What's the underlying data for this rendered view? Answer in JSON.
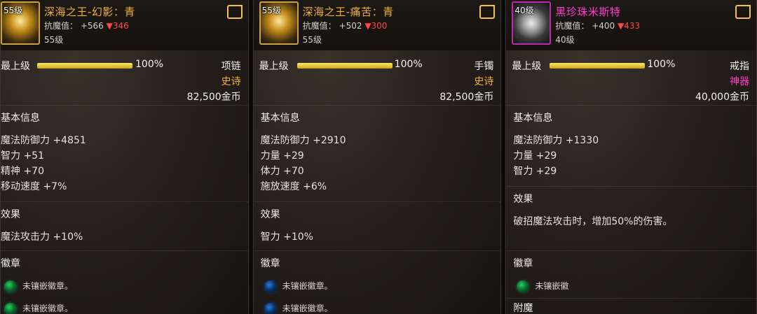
{
  "panels": [
    {
      "icon_level": "55级",
      "name": "深海之王-幻影：青",
      "resist_label": "抗魔值：",
      "resist_up": "+566",
      "resist_down": "▼346",
      "sub_level": "55级",
      "max_label": "最上级",
      "percent": "100%",
      "slot": "项链",
      "rarity": "史诗",
      "price": "82,500金币",
      "basic_info_title": "基本信息",
      "stats": [
        "魔法防御力 +4851",
        "智力 +51",
        "精神 +70",
        "移动速度 +7%"
      ],
      "effect_title": "效果",
      "effect_text": "魔法攻击力 +10%",
      "emblem_title": "徽章",
      "emblems": [
        "未镶嵌徽章。",
        "未镶嵌徽章。"
      ]
    },
    {
      "icon_level": "55级",
      "name": "深海之王-痛苦：青",
      "resist_label": "抗魔值：",
      "resist_up": "+502",
      "resist_down": "▼300",
      "sub_level": "55级",
      "max_label": "最上级",
      "percent": "100%",
      "slot": "手镯",
      "rarity": "史诗",
      "price": "82,500金币",
      "basic_info_title": "基本信息",
      "stats": [
        "魔法防御力 +2910",
        "力量 +29",
        "体力 +70",
        "施放速度 +6%"
      ],
      "effect_title": "效果",
      "effect_text": "智力 +10%",
      "emblem_title": "徽章",
      "emblems": [
        "未镶嵌徽章。",
        "未镶嵌徽章。"
      ]
    },
    {
      "icon_level": "40级",
      "name": "黑珍珠米斯特",
      "resist_label": "抗魔值：",
      "resist_up": "+400",
      "resist_down": "▼433",
      "sub_level": "40级",
      "max_label": "最上级",
      "percent": "100%",
      "slot": "戒指",
      "rarity": "神器",
      "price": "40,000金币",
      "basic_info_title": "基本信息",
      "stats": [
        "魔法防御力 +1330",
        "力量 +29",
        "智力 +29"
      ],
      "effect_title": "效果",
      "effect_text": "破招魔法攻击时，增加50%的伤害。",
      "emblem_title": "徽章",
      "emblems": [
        "未镶嵌徽"
      ],
      "extra_title": "附魔"
    }
  ],
  "progress_fraction": 1.0
}
